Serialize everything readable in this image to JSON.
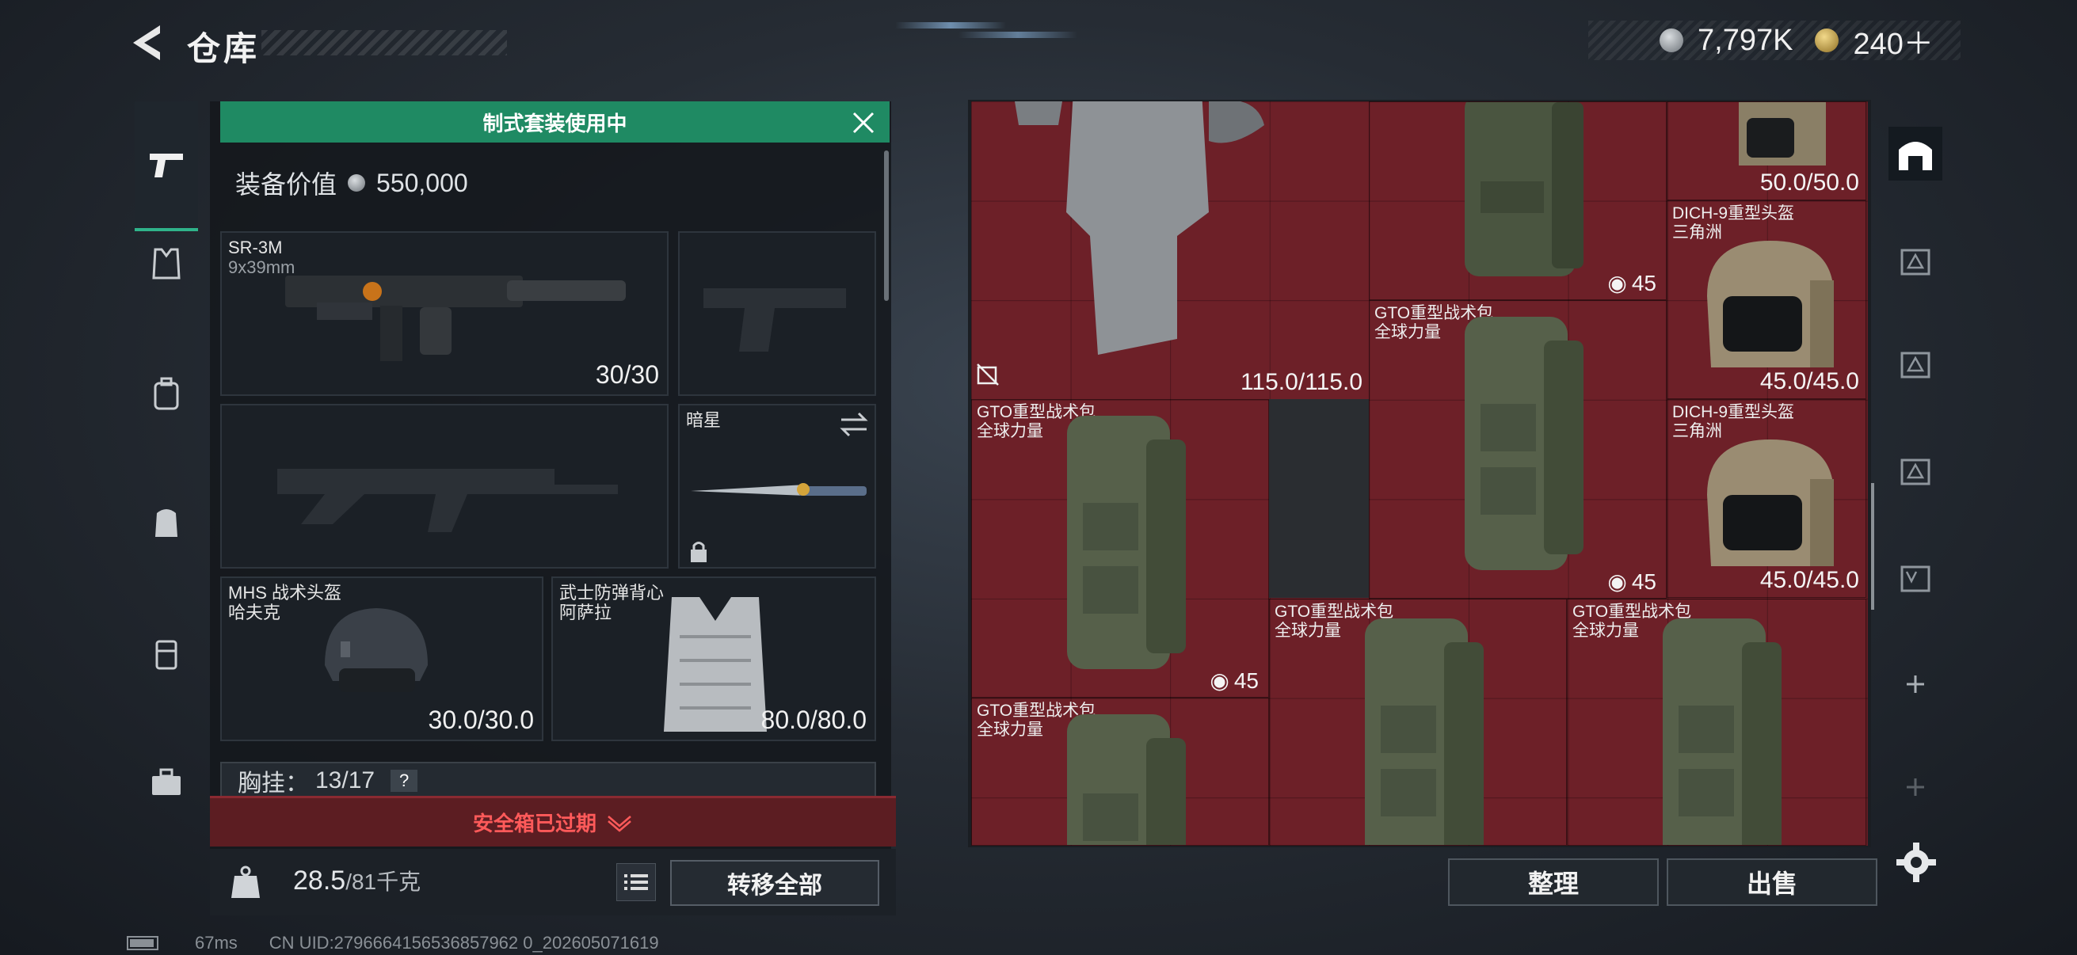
{
  "header": {
    "title": "仓库",
    "currency": [
      {
        "icon": "silver-coin-icon",
        "value": "7,797K"
      },
      {
        "icon": "gold-coin-icon",
        "value": "240＋"
      }
    ]
  },
  "left_rail": [
    "pistol-icon",
    "vest-icon",
    "backpack-icon",
    "rig-icon",
    "case-icon",
    "toolbox-icon"
  ],
  "loadout": {
    "suit_banner": "制式套装使用中",
    "equip_value_label": "装备价值",
    "equip_value": "550,000",
    "primary": {
      "name": "SR-3M",
      "ammo": "9x39mm",
      "durability": "30/30"
    },
    "melee": {
      "name": "暗星"
    },
    "helmet": {
      "name": "MHS 战术头盔",
      "sub": "哈夫克",
      "durability": "30.0/30.0"
    },
    "armor": {
      "name": "武士防弹背心",
      "sub": "阿萨拉",
      "durability": "80.0/80.0"
    },
    "rig_label": "胸挂：",
    "rig_count": "13/17",
    "rig_help": "?",
    "safe_box": "安全箱已过期",
    "weight_current": "28.5",
    "weight_max": "/81千克",
    "transfer_all": "转移全部"
  },
  "stash": {
    "items": [
      {
        "name": "",
        "sub": "",
        "value": "115.0/115.0"
      },
      {
        "name": "",
        "sub": "",
        "capacity": "45"
      },
      {
        "name": "",
        "sub": "",
        "value": "50.0/50.0"
      },
      {
        "name": "DICH-9重型头盔",
        "sub": "三角洲",
        "value": "45.0/45.0"
      },
      {
        "name": "GTO重型战术包",
        "sub": "全球力量",
        "capacity": "45"
      },
      {
        "name": "GTO重型战术包",
        "sub": "全球力量",
        "capacity": "45"
      },
      {
        "name": "DICH-9重型头盔",
        "sub": "三角洲",
        "value": "45.0/45.0"
      },
      {
        "name": "GTO重型战术包",
        "sub": "全球力量",
        "capacity": ""
      },
      {
        "name": "GTO重型战术包",
        "sub": "全球力量",
        "capacity": ""
      },
      {
        "name": "GTO重型战术包",
        "sub": "全球力量",
        "capacity": ""
      }
    ],
    "sort": "整理",
    "sell": "出售"
  },
  "footer": {
    "ping": "67ms",
    "uid": "CN UID:2796664156536857962 0_202605071619"
  },
  "colors": {
    "accent": "#1f8a63",
    "stash_bg": "#6d2028",
    "warning": "#ff5a5a"
  }
}
